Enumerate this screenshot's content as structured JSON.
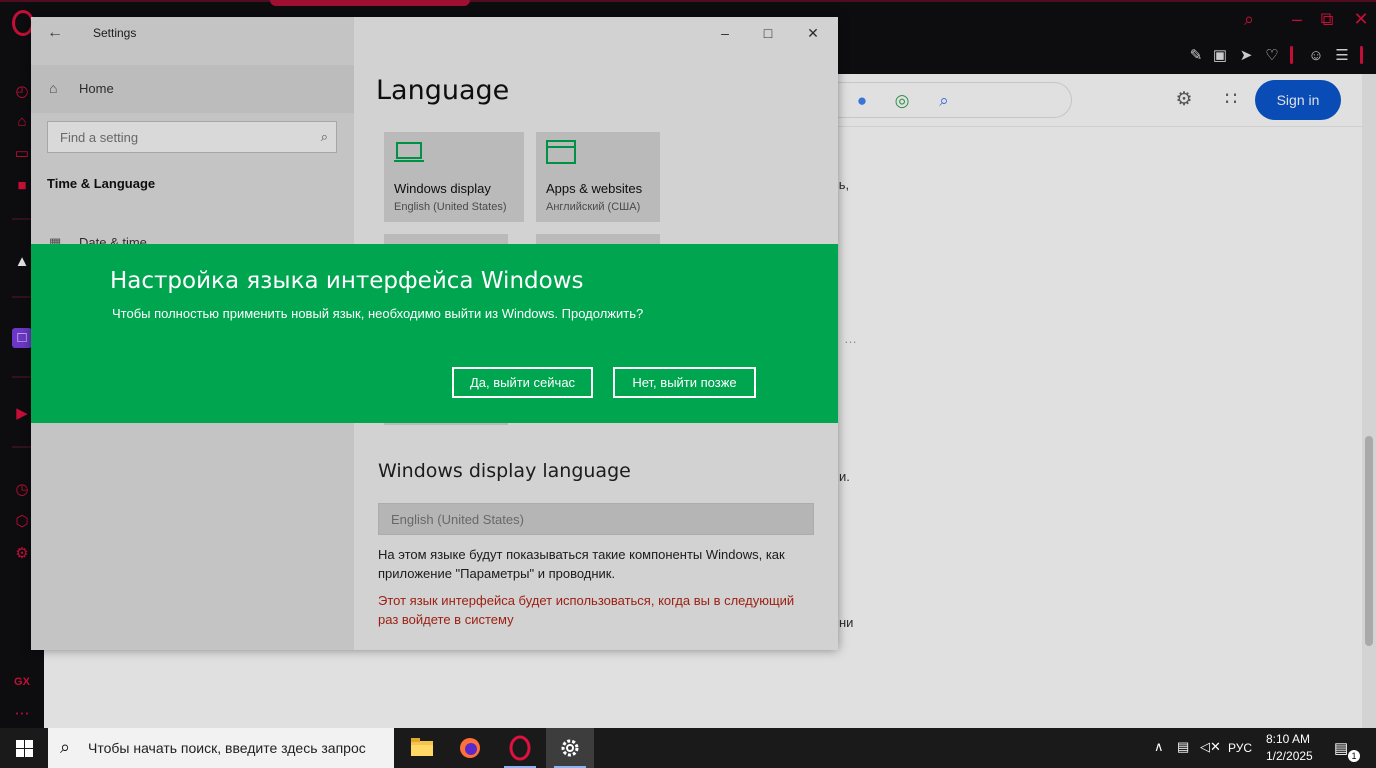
{
  "browser": {
    "toolbar_icons": [
      "snapshot-edit-icon",
      "camera-icon",
      "send-icon",
      "heart-icon",
      "profile-icon",
      "menu-icon"
    ],
    "sidebar_icons": [
      "speed-dial-icon",
      "gx-control-icon",
      "gx-cleaner-icon",
      "messenger-icon",
      "ai-icon",
      "twitch-icon",
      "player-icon",
      "history-icon",
      "extensions-icon",
      "settings-icon"
    ],
    "sidebar_badge": "GX",
    "accent": "#e0113f"
  },
  "google": {
    "signin_label": "Sign in",
    "page_fragments": [
      "ышь,",
      "и.",
      "ни"
    ]
  },
  "settings": {
    "window_title": "Settings",
    "nav_home": "Home",
    "find_placeholder": "Find a setting",
    "nav_section": "Time & Language",
    "nav_datetime": "Date & time",
    "heading": "Language",
    "tiles": [
      {
        "title": "Windows display",
        "subtitle": "English (United States)"
      },
      {
        "title": "Apps & websites",
        "subtitle": "Английский (США)"
      }
    ],
    "display_language_heading": "Windows display language",
    "display_language_value": "English (United States)",
    "display_language_desc": "На этом языке будут показываться такие компоненты Windows, как приложение \"Параметры\" и проводник.",
    "display_language_warning": "Этот язык интерфейса будет использоваться, когда вы в следующий раз войдете в систему"
  },
  "dialog": {
    "title": "Настройка языка интерфейса Windows",
    "message": "Чтобы полностью применить новый язык, необходимо выйти из Windows. Продолжить?",
    "confirm_label": "Да, выйти сейчас",
    "cancel_label": "Нет, выйти позже",
    "color": "#00a550"
  },
  "taskbar": {
    "search_placeholder": "Чтобы начать поиск, введите здесь запрос",
    "language": "РУС",
    "time": "8:10 AM",
    "date": "1/2/2025",
    "notification_count": "1"
  }
}
